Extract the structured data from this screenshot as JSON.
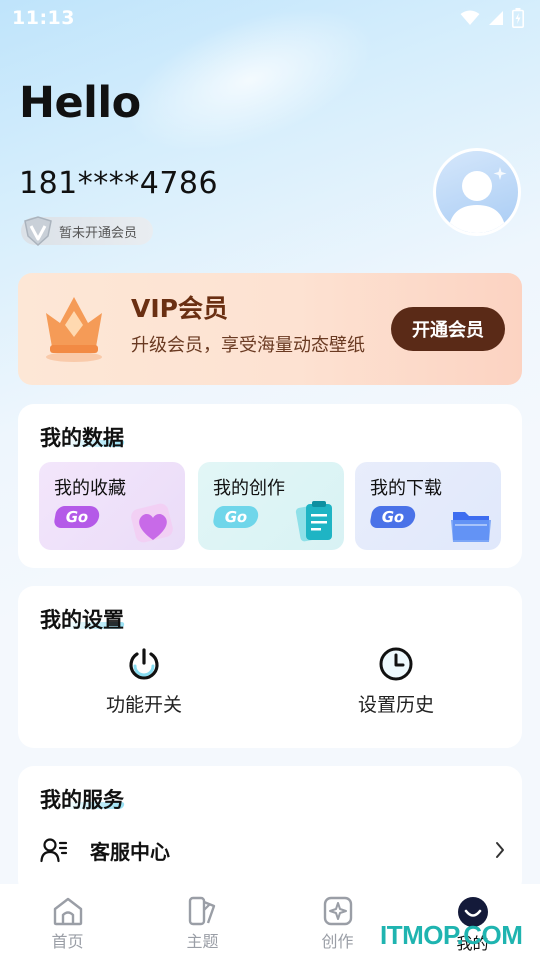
{
  "status_bar": {
    "time": "11:13"
  },
  "profile": {
    "greeting": "Hello",
    "phone": "181****4786",
    "member_status": "暂未开通会员"
  },
  "vip": {
    "title": "VIP会员",
    "subtitle": "升级会员，享受海量动态壁纸",
    "button_label": "开通会员"
  },
  "my_data": {
    "title": "我的数据",
    "tiles": [
      {
        "label": "我的收藏",
        "go": "Go",
        "icon": "heart-icon",
        "color": "#b45ae8"
      },
      {
        "label": "我的创作",
        "go": "Go",
        "icon": "clipboard-icon",
        "color": "#6fd6ea"
      },
      {
        "label": "我的下载",
        "go": "Go",
        "icon": "folder-icon",
        "color": "#4a72e8"
      }
    ]
  },
  "my_settings": {
    "title": "我的设置",
    "items": [
      {
        "label": "功能开关",
        "icon": "power-icon"
      },
      {
        "label": "设置历史",
        "icon": "clock-icon"
      }
    ]
  },
  "my_services": {
    "title": "我的服务",
    "items": [
      {
        "label": "客服中心",
        "icon": "customer-service-icon"
      }
    ]
  },
  "tabbar": {
    "tabs": [
      {
        "label": "首页",
        "icon": "home-icon",
        "active": false
      },
      {
        "label": "主题",
        "icon": "theme-icon",
        "active": false
      },
      {
        "label": "创作",
        "icon": "create-icon",
        "active": false
      },
      {
        "label": "我的",
        "icon": "profile-icon",
        "active": true
      }
    ]
  },
  "watermark": "ITMOP.COM"
}
